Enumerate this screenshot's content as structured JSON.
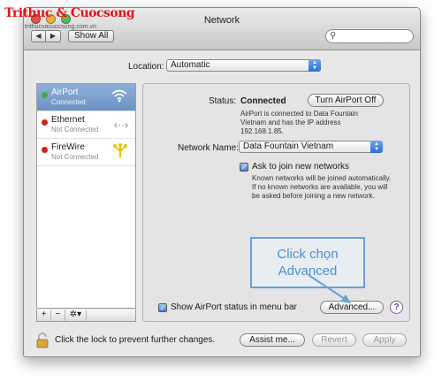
{
  "window": {
    "title": "Network"
  },
  "toolbar": {
    "back_label": "◀",
    "forward_label": "▶",
    "show_all_label": "Show All",
    "search_placeholder": ""
  },
  "watermark": {
    "text": "Trithuc & Cuocsong",
    "url": "trithucvacuocsong.com.vn"
  },
  "location": {
    "label": "Location:",
    "value": "Automatic"
  },
  "services": [
    {
      "name": "AirPort",
      "status": "Connected",
      "status_color": "#3fae3f",
      "icon": "wifi-icon",
      "selected": true
    },
    {
      "name": "Ethernet",
      "status": "Not Connected",
      "status_color": "#d02020",
      "icon": "ethernet-icon",
      "selected": false
    },
    {
      "name": "FireWire",
      "status": "Not Connected",
      "status_color": "#d02020",
      "icon": "firewire-icon",
      "selected": false
    }
  ],
  "sidebar_bottom": {
    "add": "+",
    "remove": "−",
    "gear": "✲▾"
  },
  "detail": {
    "status_label": "Status:",
    "status_value": "Connected",
    "turn_off_label": "Turn AirPort Off",
    "status_desc": "AirPort is connected to Data Fountain Vietnam and has the IP address 192.168.1.85.",
    "network_name_label": "Network Name:",
    "network_name_value": "Data Fountain Vietnam",
    "ask_join_label": "Ask to join new networks",
    "ask_join_desc": "Known networks will be joined automatically. If no known networks are available, you will be asked before joining a new network.",
    "callout_text": "Click chọn Advanced",
    "show_status_label": "Show AirPort status in menu bar",
    "advanced_label": "Advanced...",
    "help_label": "?"
  },
  "footer": {
    "lock_text": "Click the lock to prevent further changes.",
    "assist_label": "Assist me...",
    "revert_label": "Revert",
    "apply_label": "Apply"
  },
  "colors": {
    "accent": "#3d7ed8",
    "callout": "#6aa0d8"
  }
}
